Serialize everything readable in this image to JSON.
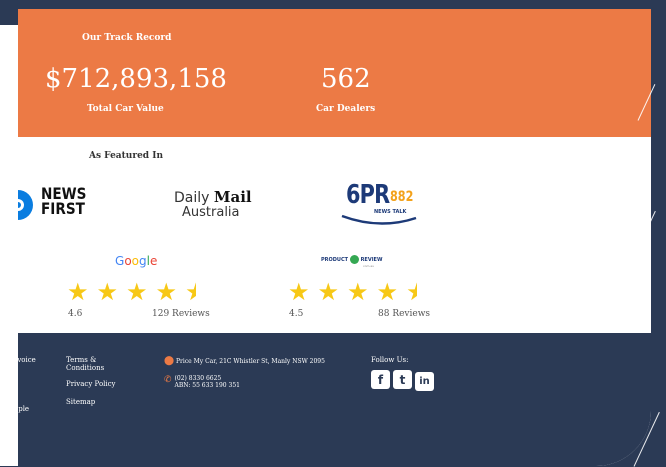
{
  "track_record": {
    "title": "Our Track Record",
    "car_value": "$712,893,158",
    "car_value_label": "Total Car Value",
    "dealers": "562",
    "dealers_label": "Car Dealers"
  },
  "featured": {
    "title": "As Featured In",
    "newsfirst": [
      "NEWS",
      "FIRST"
    ],
    "dailymail": [
      "Daily ",
      "Mail",
      "Australia"
    ],
    "sixpr": [
      "6PR",
      "882",
      "NEWS TALK"
    ]
  },
  "reviews": {
    "google": {
      "logo": "Google",
      "rating": "4.6",
      "count": "129 Reviews",
      "stars_value": 4.5
    },
    "productreview": {
      "logo_left": "PRODUCT",
      "logo_right": "REVIEW",
      "logo_sub": "com.au",
      "rating": "4.5",
      "count": "88 Reviews",
      "stars_value": 4.5
    }
  },
  "footer": {
    "left_partial": [
      "rvoice",
      "y",
      "ople"
    ],
    "links": [
      "Terms &",
      "Conditions",
      "Privacy Policy",
      "Sitemap"
    ],
    "address": "Price My Car, 21C Whistler St, Manly NSW 2095",
    "phone": "(02) 8330 6625",
    "abn": "ABN: 55 633 190 351",
    "follow": "Follow Us:",
    "social": [
      "f",
      "t",
      "in"
    ]
  },
  "colors": {
    "orange": "#ec7a45",
    "navy": "#2b3a55",
    "star": "#f7c816"
  }
}
